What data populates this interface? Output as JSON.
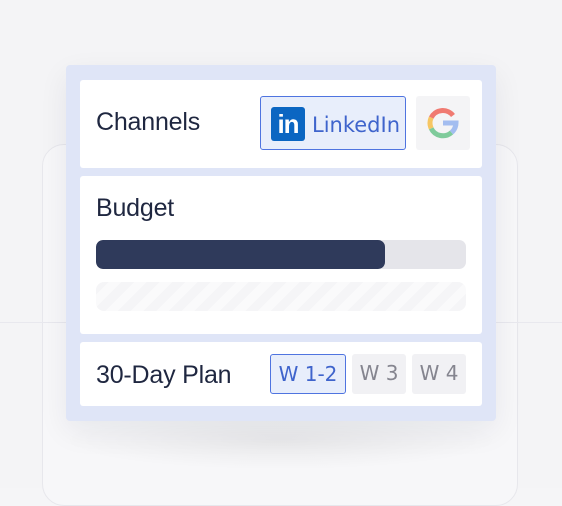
{
  "channels": {
    "title": "Channels",
    "items": [
      {
        "name": "LinkedIn",
        "icon": "linkedin-logo",
        "selected": true,
        "logo_text": "in"
      },
      {
        "name": "Google",
        "icon": "google-logo",
        "selected": false
      }
    ]
  },
  "budget": {
    "title": "Budget",
    "primary_fill_fraction": 0.78,
    "secondary_fill_fraction": 0
  },
  "plan": {
    "title": "30-Day Plan",
    "weeks": [
      {
        "label": "W 1-2",
        "selected": true
      },
      {
        "label": "W 3",
        "selected": false
      },
      {
        "label": "W 4",
        "selected": false
      }
    ]
  },
  "colors": {
    "accent": "#4f74e0",
    "bar_fill": "#2f3a5b",
    "linkedin_blue": "#0b66c2"
  }
}
